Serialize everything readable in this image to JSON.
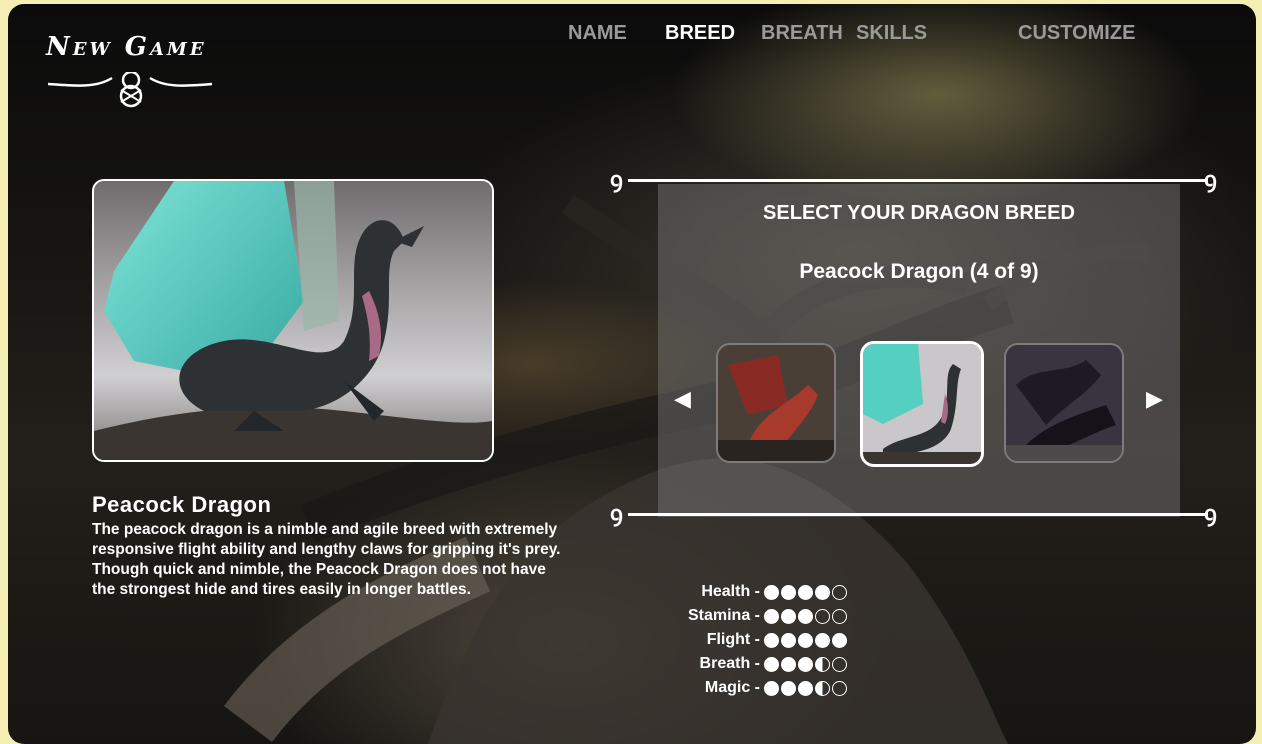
{
  "logo": {
    "text": "New Game"
  },
  "nav": {
    "items": [
      {
        "label": "NAME",
        "active": false
      },
      {
        "label": "BREED",
        "active": true
      },
      {
        "label": "BREATH",
        "active": false
      },
      {
        "label": "SKILLS",
        "active": false
      },
      {
        "label": "CUSTOMIZE",
        "active": false
      }
    ]
  },
  "breed": {
    "name": "Peacock Dragon",
    "description": "The peacock dragon is a nimble and agile breed with extremely responsive flight ability and lengthy claws for gripping it's prey. Though quick and nimble, the Peacock Dragon does not have the strongest hide and tires easily in longer battles."
  },
  "selector": {
    "heading": "SELECT YOUR DRAGON BREED",
    "current": "Peacock Dragon (4 of 9)",
    "prev_arrow": "◀",
    "next_arrow": "▶"
  },
  "stats": [
    {
      "label": "Health -",
      "value": 4,
      "max": 5
    },
    {
      "label": "Stamina -",
      "value": 3,
      "max": 5
    },
    {
      "label": "Flight -",
      "value": 5,
      "max": 5
    },
    {
      "label": "Breath -",
      "value": 3.5,
      "max": 5
    },
    {
      "label": "Magic -",
      "value": 3.5,
      "max": 5
    }
  ],
  "colors": {
    "background": "#f6efb4",
    "frame": "#0b0b0b",
    "text": "#ffffff",
    "nav_inactive": "#9a9a9a",
    "teal_wing": "#4fd1c1"
  }
}
